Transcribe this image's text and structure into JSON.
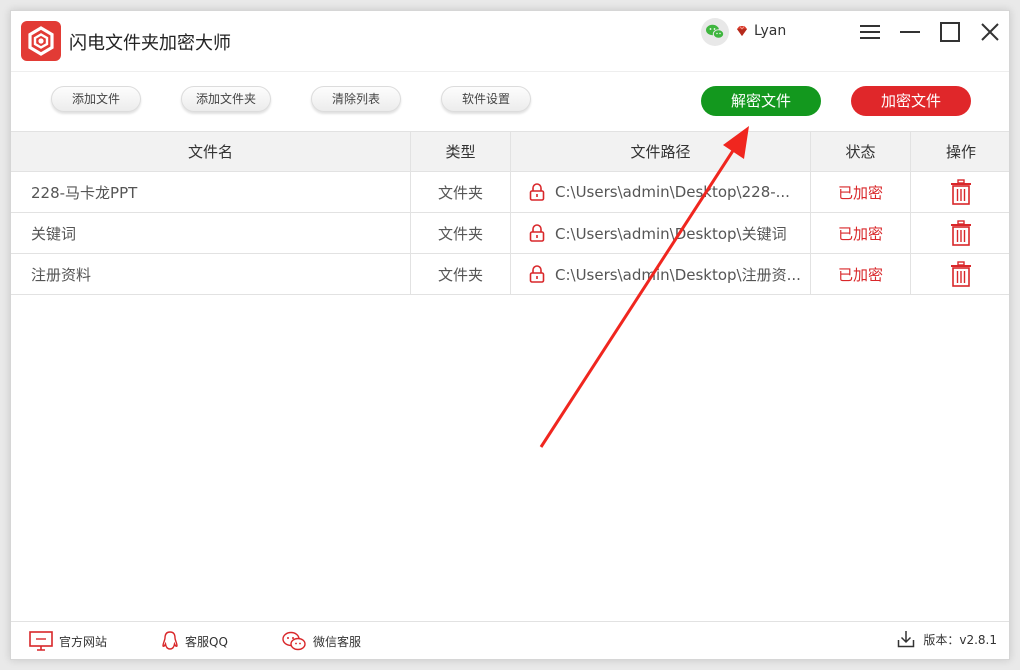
{
  "app": {
    "title": "闪电文件夹加密大师"
  },
  "user": {
    "name": "Lyan"
  },
  "toolbar": {
    "add_file": "添加文件",
    "add_folder": "添加文件夹",
    "clear_list": "清除列表",
    "settings": "软件设置",
    "decrypt": "解密文件",
    "encrypt": "加密文件"
  },
  "table": {
    "headers": {
      "name": "文件名",
      "type": "类型",
      "path": "文件路径",
      "status": "状态",
      "op": "操作"
    },
    "rows": [
      {
        "name": "228-马卡龙PPT",
        "type": "文件夹",
        "path": "C:\\Users\\admin\\Desktop\\228-...",
        "status": "已加密"
      },
      {
        "name": "关键词",
        "type": "文件夹",
        "path": "C:\\Users\\admin\\Desktop\\关键词",
        "status": "已加密"
      },
      {
        "name": "注册资料",
        "type": "文件夹",
        "path": "C:\\Users\\admin\\Desktop\\注册资...",
        "status": "已加密"
      }
    ]
  },
  "footer": {
    "website": "官方网站",
    "qq": "客服QQ",
    "wechat": "微信客服",
    "version": "版本：v2.8.1"
  },
  "colors": {
    "accent_red": "#e0272a",
    "accent_green": "#13981e"
  },
  "icons": [
    "app-logo-icon",
    "wechat-icon",
    "gem-icon",
    "menu-icon",
    "minimize-icon",
    "maximize-icon",
    "close-icon",
    "lock-icon",
    "trash-icon",
    "monitor-icon",
    "qq-icon",
    "wechat-service-icon",
    "download-icon",
    "annotation-arrow"
  ]
}
